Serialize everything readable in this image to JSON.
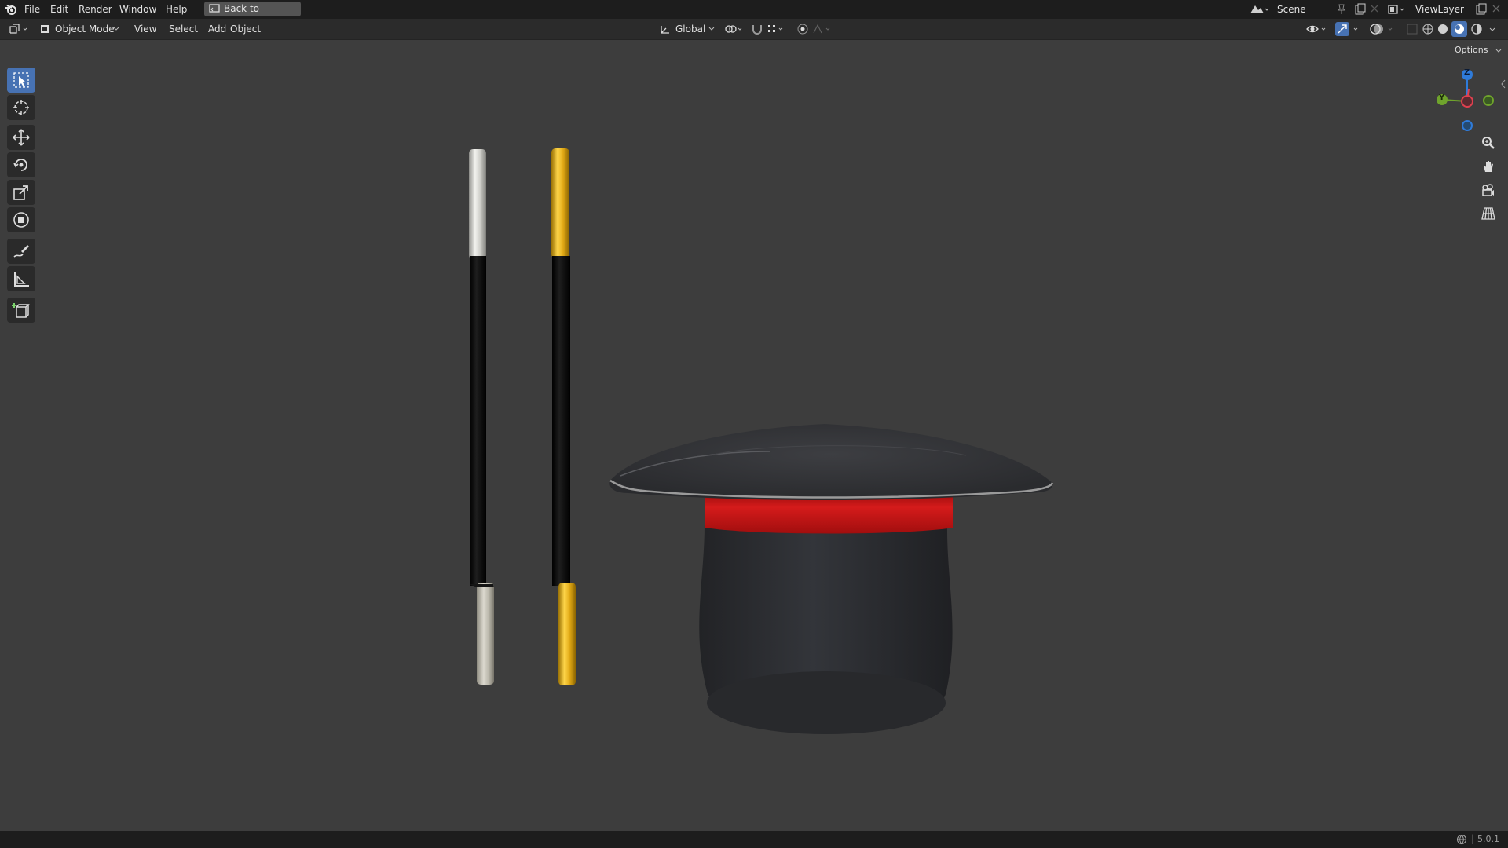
{
  "topbar": {
    "menus": [
      "File",
      "Edit",
      "Render",
      "Window",
      "Help"
    ],
    "back_button": "Back to Previous",
    "scene_name": "Scene",
    "view_layer_name": "ViewLayer"
  },
  "header": {
    "mode": "Object Mode",
    "menus": [
      "View",
      "Select",
      "Add",
      "Object"
    ],
    "transform_orientation": "Global",
    "options_label": "Options"
  },
  "toolbar": {
    "tools": [
      "select-box",
      "cursor",
      "move",
      "rotate",
      "scale",
      "transform",
      "annotate",
      "measure",
      "add-cube"
    ],
    "active_tool": "select-box"
  },
  "gizmo": {
    "axes": [
      {
        "label": "Z",
        "color": "#2f7bd9"
      },
      {
        "label": "Y",
        "color": "#6fa32c"
      },
      {
        "label": "",
        "color": "#e0404f"
      }
    ]
  },
  "status": {
    "version": "5.0.1"
  },
  "colors": {
    "accent": "#4772b3",
    "viewport_bg": "#3d3d3d",
    "silver": "#c9c9c5",
    "gold": "#d7a41c",
    "hat_band": "#c51616",
    "hat_body": "#2b2c2e"
  },
  "scene_objects": [
    "silver-tipped wand",
    "gold-tipped wand",
    "top hat with red band"
  ]
}
